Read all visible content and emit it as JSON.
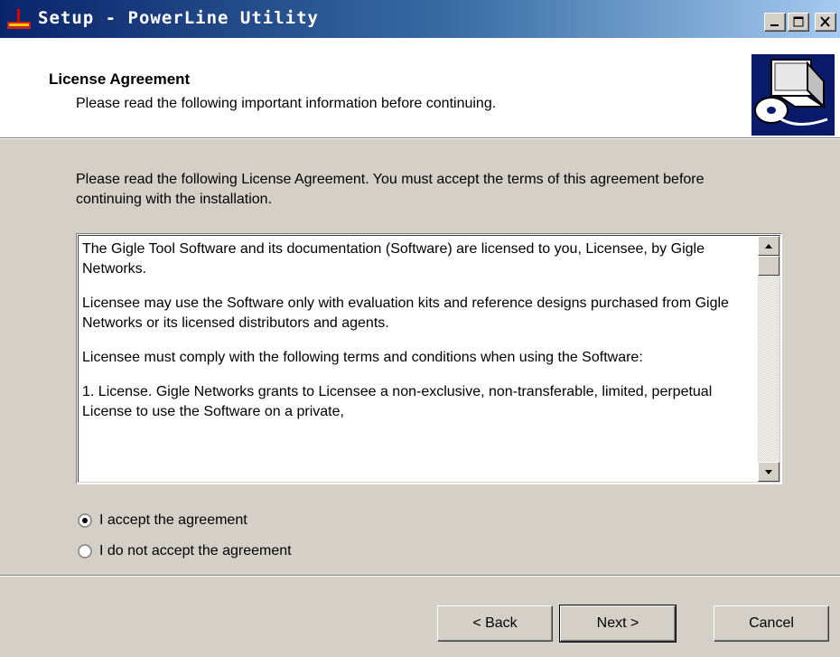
{
  "window": {
    "title": "Setup - PowerLine Utility",
    "controls": {
      "minimize": "minimize-icon",
      "maximize": "maximize-icon",
      "close": "close-icon"
    }
  },
  "header": {
    "title": "License Agreement",
    "subtitle": "Please read the following important information before continuing.",
    "icon": "computer-disc-install-icon"
  },
  "intro": "Please read the following License Agreement. You must accept the terms of this agreement before continuing with the installation.",
  "license": {
    "paragraphs": [
      "The Gigle Tool Software and its documentation (Software) are licensed to you, Licensee, by Gigle Networks.",
      "Licensee may use the Software only with evaluation kits and reference designs purchased from Gigle Networks or its licensed distributors and agents.",
      "Licensee must comply with the following terms and conditions when using the Software:",
      "1. License. Gigle Networks grants to Licensee a non-exclusive, non-transferable, limited, perpetual License to use the Software on a private,"
    ]
  },
  "options": {
    "accept": {
      "label": "I accept the agreement",
      "selected": true
    },
    "decline": {
      "label": "I do not accept the agreement",
      "selected": false
    }
  },
  "buttons": {
    "back": "< Back",
    "next": "Next >",
    "cancel": "Cancel"
  },
  "colors": {
    "titlebar_start": "#0a246a",
    "titlebar_end": "#a6caf0",
    "face": "#d4d0c8"
  }
}
